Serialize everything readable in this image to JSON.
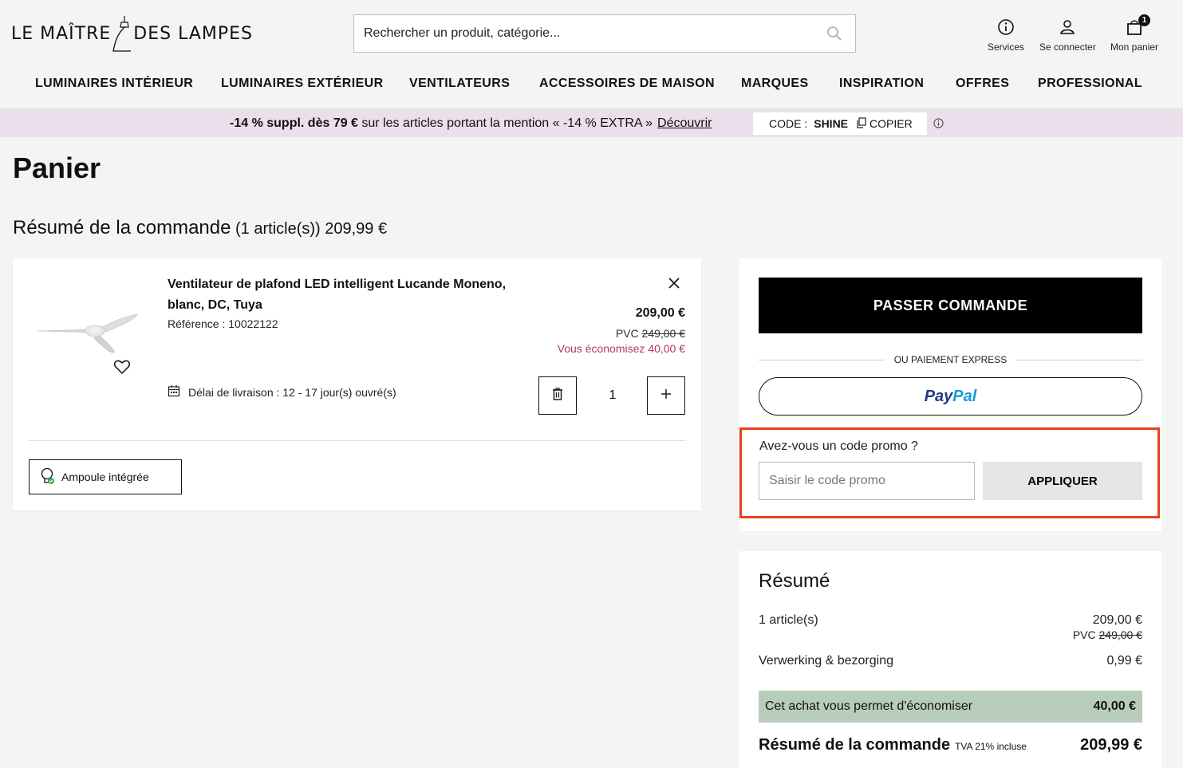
{
  "brand": {
    "logo_left": "LE MAÎTRE",
    "logo_right": "DES LAMPES"
  },
  "search": {
    "placeholder": "Rechercher un produit, catégorie..."
  },
  "header_utils": {
    "services": "Services",
    "login": "Se connecter",
    "cart": "Mon panier",
    "cart_count": "1"
  },
  "nav": [
    "LUMINAIRES INTÉRIEUR",
    "LUMINAIRES EXTÉRIEUR",
    "VENTILATEURS",
    "ACCESSOIRES DE MAISON",
    "MARQUES",
    "INSPIRATION",
    "OFFRES",
    "PROFESSIONAL"
  ],
  "banner": {
    "bold": "-14 % suppl. dès 79 €",
    "text": " sur les articles portant la mention « -14 % EXTRA »",
    "link": "Découvrir",
    "code_label": "CODE :",
    "code_value": "SHINE",
    "copy_label": "COPIER"
  },
  "page": {
    "title": "Panier",
    "summary_heading": "Résumé de la commande",
    "summary_sub": " (1 article(s)) 209,99 €"
  },
  "item": {
    "name": "Ventilateur de plafond LED intelligent Lucande Moneno, blanc, DC, Tuya",
    "reference": "Référence : 10022122",
    "price": "209,00 €",
    "pvc_label": "PVC ",
    "pvc_value": "249,00 €",
    "savings": "Vous économisez 40,00 €",
    "delivery": "Délai de livraison : 12 - 17 jour(s) ouvré(s)",
    "quantity": "1",
    "chip": "Ampoule intégrée"
  },
  "checkout": {
    "button": "PASSER COMMANDE",
    "express": "OU PAIEMENT EXPRESS",
    "paypal_1": "Pay",
    "paypal_2": "Pal",
    "promo_label": "Avez-vous un code promo ?",
    "promo_placeholder": "Saisir le code promo",
    "promo_apply": "APPLIQUER"
  },
  "recap": {
    "title": "Résumé",
    "items_label": "1 article(s)",
    "items_value": "209,00 €",
    "items_pvc_label": "PVC ",
    "items_pvc_value": "249,00 €",
    "handling_label": "Verwerking & bezorging",
    "handling_value": "0,99 €",
    "savings_label": "Cet achat vous permet d'économiser",
    "savings_value": "40,00 €",
    "total_label": "Résumé de la commande",
    "total_tva": "TVA 21% incluse",
    "total_value": "209,99 €"
  },
  "colors": {
    "banner_bg": "#ecdfec",
    "promo_border": "#e8401a",
    "savings_bg": "#b8ccba",
    "savings_text": "#b03a5b"
  }
}
